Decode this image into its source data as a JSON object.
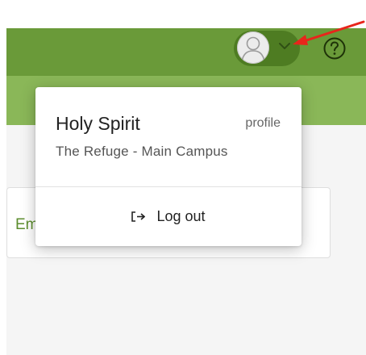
{
  "header": {
    "colors": {
      "topbar": "#6a9a39",
      "subbar": "#8ab758",
      "pill": "#4e7c22"
    },
    "icons": {
      "avatar": "user-avatar-icon",
      "chevron": "chevron-down-icon",
      "help": "help-circle-icon"
    }
  },
  "background": {
    "card_text": "Em"
  },
  "dropdown": {
    "user_name": "Holy Spirit",
    "profile_link": "profile",
    "campus": "The Refuge - Main Campus",
    "logout_label": "Log out",
    "logout_icon": "logout-icon"
  },
  "annotation": {
    "arrow_color": "#e8251b",
    "icon": "red-arrow-annotation"
  }
}
